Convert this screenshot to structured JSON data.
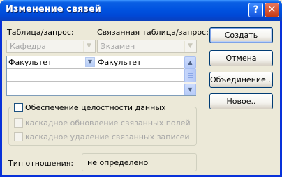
{
  "window": {
    "title": "Изменение связей",
    "help_glyph": "?",
    "close_glyph": "✕"
  },
  "labels": {
    "table_query": "Таблица/запрос:",
    "related_table_query": "Связанная таблица/запрос:"
  },
  "combos": {
    "table_value": "Кафедра",
    "related_value": "Экзамен",
    "arrow": "▼"
  },
  "fields_grid": {
    "rows": [
      {
        "left": "Факультет",
        "right": "Факультет"
      },
      {
        "left": "",
        "right": ""
      },
      {
        "left": "",
        "right": ""
      }
    ],
    "scroll_up": "▲",
    "scroll_down": "▼",
    "cell_dropdown": "▼"
  },
  "options": {
    "enforce_integrity": {
      "label": "Обеспечение целостности данных",
      "checked": false,
      "enabled": true
    },
    "cascade_update": {
      "label": "каскадное обновление связанных полей",
      "checked": false,
      "enabled": false
    },
    "cascade_delete": {
      "label": "каскадное удаление связанных записей",
      "checked": false,
      "enabled": false
    }
  },
  "relationship": {
    "label": "Тип отношения:",
    "value": "не определено"
  },
  "buttons": {
    "create": "Создать",
    "cancel": "Отмена",
    "join": "Объединение...",
    "new": "Новое.."
  }
}
